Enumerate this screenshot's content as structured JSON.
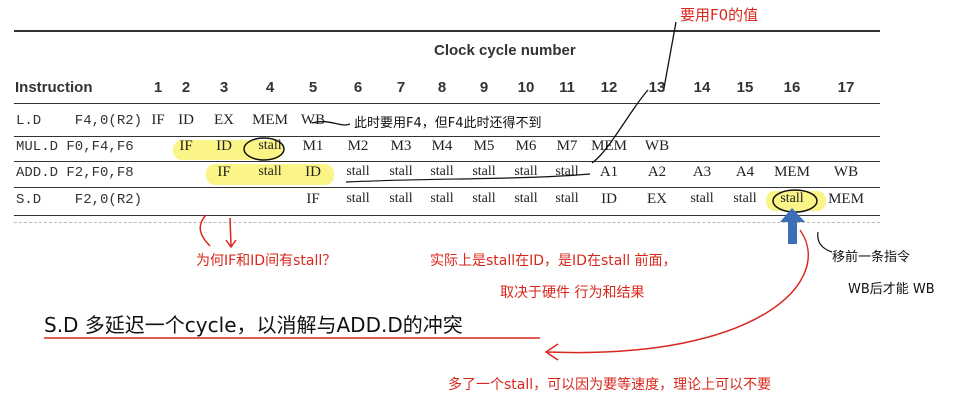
{
  "table": {
    "header_title": "Clock cycle number",
    "instruction_header": "Instruction",
    "cycles": [
      "1",
      "2",
      "3",
      "4",
      "5",
      "6",
      "7",
      "8",
      "9",
      "10",
      "11",
      "12",
      "13",
      "14",
      "15",
      "16",
      "17"
    ],
    "rows": [
      {
        "instruction": "L.D    F4,0(R2)",
        "stages": [
          "IF",
          "ID",
          "EX",
          "MEM",
          "WB",
          "",
          "",
          "",
          "",
          "",
          "",
          "",
          "",
          "",
          "",
          "",
          ""
        ]
      },
      {
        "instruction": "MUL.D F0,F4,F6",
        "stages": [
          "",
          "IF",
          "ID",
          "stall",
          "M1",
          "M2",
          "M3",
          "M4",
          "M5",
          "M6",
          "M7",
          "MEM",
          "WB",
          "",
          "",
          "",
          ""
        ]
      },
      {
        "instruction": "ADD.D F2,F0,F8",
        "stages": [
          "",
          "",
          "IF",
          "stall",
          "ID",
          "stall",
          "stall",
          "stall",
          "stall",
          "stall",
          "stall",
          "A1",
          "A2",
          "A3",
          "A4",
          "MEM",
          "WB"
        ]
      },
      {
        "instruction": "S.D    F2,0(R2)",
        "stages": [
          "",
          "",
          "",
          "",
          "IF",
          "stall",
          "stall",
          "stall",
          "stall",
          "stall",
          "stall",
          "ID",
          "EX",
          "stall",
          "stall",
          "stall",
          "MEM"
        ]
      }
    ]
  },
  "annotations": {
    "top_right": "要用F0的值",
    "row1_note": "此时要用F4，但F4此时还得不到",
    "question": "为何IF和ID间有stall？",
    "explain_line1": "实际上是stall在ID，是ID在stall 前面，",
    "explain_line2": "取决于硬件 行为和结果",
    "right_note_line1": "移前一条指令",
    "right_note_line2": "WB后才能 WB",
    "main_caption": "S.D 多延迟一个cycle，以消解与ADD.D的冲突",
    "bottom_note": "多了一个stall，可以因为要等速度，理论上可以不要"
  },
  "colors": {
    "annotation_red": "#d9271d",
    "highlight_yellow": "#fbf37a",
    "arrow_blue": "#3b6fb6"
  }
}
